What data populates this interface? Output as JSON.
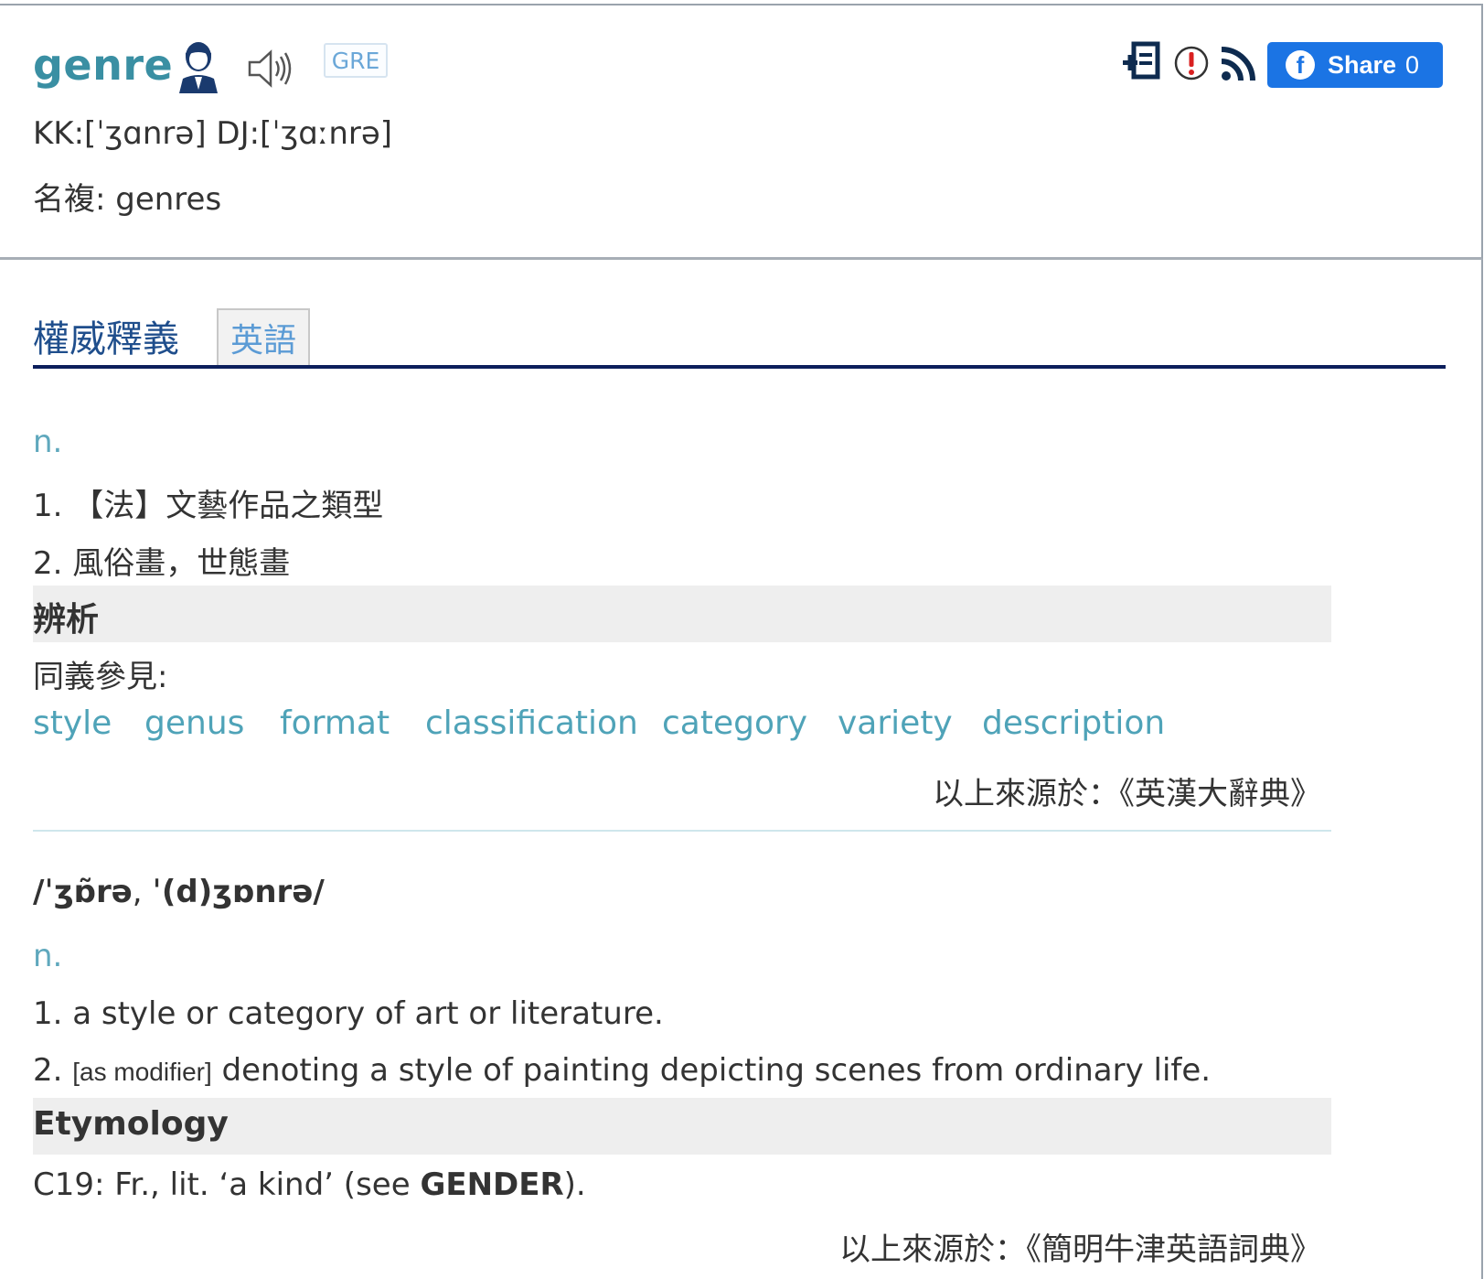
{
  "entry": {
    "headword": "genre",
    "badge": "GRE",
    "pronunciation": "KK:[ˈʒɑnrə] DJ:[ˈʒɑːnrə]",
    "plural": "名複: genres"
  },
  "share": {
    "label": "Share",
    "count": "0"
  },
  "tabs": {
    "section_title": "權威釋義",
    "english_tab": "英語"
  },
  "dict1": {
    "pos": "n.",
    "definitions": [
      "1. 【法】文藝作品之類型",
      "2. 風俗畫，世態畫"
    ],
    "analysis_label": "辨析",
    "synonyms_label": "同義參見:",
    "synonyms": [
      "style",
      "genus",
      "format",
      "classification",
      "category",
      "variety",
      "description"
    ],
    "source": "以上來源於：《英漢大辭典》"
  },
  "dict2": {
    "pron_a": "/ˈʒɒ̃rə",
    "pron_sep": ", ",
    "pron_b": "ˈ(d)ʒɒnrə/",
    "pos": "n.",
    "def1": "1. a style or category of art or literature.",
    "def2_num": "2. ",
    "def2_modifier": "[as modifier]",
    "def2_text": " denoting a style of painting depicting scenes from ordinary life.",
    "etymology_label": "Etymology",
    "etym_text": "C19: Fr., lit. ‘a kind’ (see ",
    "etym_bold": "GENDER",
    "etym_end": ").",
    "source": "以上來源於：《簡明牛津英語詞典》"
  },
  "icons": [
    "person-icon",
    "speaker-icon",
    "add-to-wordbook-icon",
    "report-error-icon",
    "rss-icon",
    "facebook-icon"
  ],
  "colors": {
    "headword": "#3a8fa3",
    "link": "#4fa3b8",
    "share_bg": "#1b74e4",
    "section_rule": "#0c1f5c"
  }
}
